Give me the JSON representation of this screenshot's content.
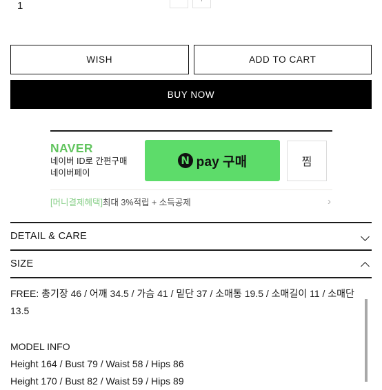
{
  "quantity": {
    "value": "1",
    "decrease_label": "−",
    "increase_label": "+"
  },
  "actions": {
    "wish_label": "WISH",
    "add_to_cart_label": "ADD TO CART",
    "buy_now_label": "BUY NOW"
  },
  "naver_pay": {
    "logo": "NAVER",
    "sub_line_1": "네이버 ID로 간편구매",
    "sub_line_2": "네이버페이",
    "pay_button": {
      "mark": "N",
      "pay_text": "pay",
      "action_text": "구매"
    },
    "zzim_label": "찜",
    "benefit": {
      "tag": "[머니결제혜택]",
      "text": "최대 3%적립 + 소득공제",
      "chevron": "›"
    }
  },
  "sections": {
    "detail_care": {
      "title": "DETAIL & CARE",
      "state": "collapsed"
    },
    "size": {
      "title": "SIZE",
      "state": "expanded",
      "measurements": "FREE: 총기장 46 / 어깨 34.5 / 가슴 41 / 밑단 37 / 소매통 19.5 / 소매길이 11 / 소매단 13.5",
      "model_info": {
        "heading": "MODEL INFO",
        "lines": [
          "Height 164 / Bust 79 / Waist 58 / Hips 86",
          "Height 170 / Bust 82 / Waist 59 / Hips 89"
        ]
      }
    }
  },
  "colors": {
    "naver_green": "#61c45e",
    "npay_button_green": "#5ddc6a",
    "buy_now_bg": "#000000",
    "benefit_tag_green": "#89cf8a",
    "scrollbar_thumb": "#a8a8a8"
  }
}
